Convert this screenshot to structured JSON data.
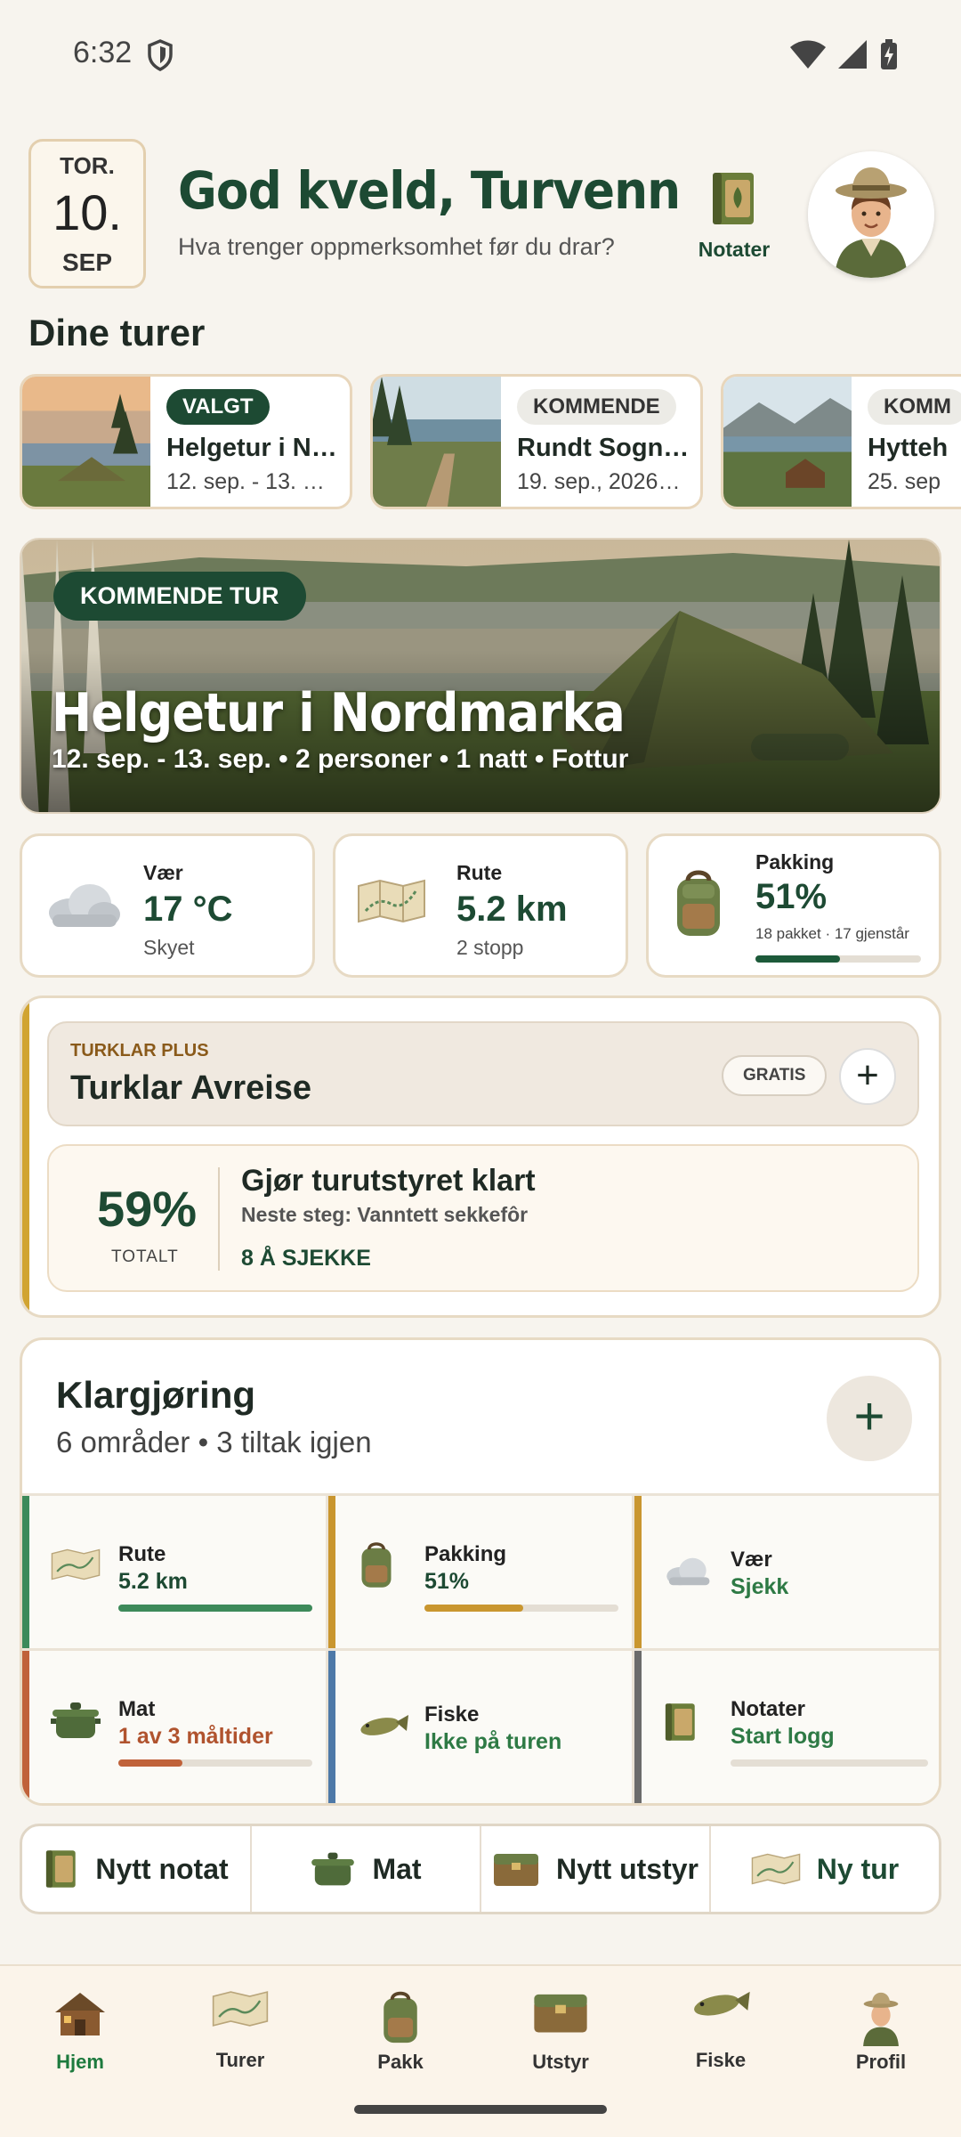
{
  "status": {
    "time": "6:32"
  },
  "header": {
    "date": {
      "dow": "TOR.",
      "day": "10.",
      "month": "SEP"
    },
    "title": "God kveld, Turvenn",
    "subtitle": "Hva trenger oppmerksomhet før du drar?",
    "notes_label": "Notater"
  },
  "trips": {
    "section_title": "Dine turer",
    "items": [
      {
        "badge": "VALGT",
        "name": "Helgetur i N…",
        "dates": "12. sep. - 13. …"
      },
      {
        "badge": "KOMMENDE",
        "name": "Rundt Sogns…",
        "dates": "19. sep., 2026…"
      },
      {
        "badge": "KOMM",
        "name": "Hytteh",
        "dates": "25. sep"
      }
    ]
  },
  "hero": {
    "badge": "KOMMENDE TUR",
    "title": "Helgetur i Nordmarka",
    "subtitle": "12. sep. - 13. sep. • 2 personer • 1 natt • Fottur"
  },
  "stats": {
    "weather": {
      "label": "Vær",
      "value": "17 °C",
      "sub": "Skyet"
    },
    "route": {
      "label": "Rute",
      "value": "5.2 km",
      "sub": "2 stopp"
    },
    "packing": {
      "label": "Pakking",
      "value": "51%",
      "sub": "18 pakket · 17 gjenstår",
      "progress": 0.51
    }
  },
  "turklar": {
    "kicker": "TURKLAR PLUS",
    "title": "Turklar Avreise",
    "gratis": "GRATIS",
    "percent": "59%",
    "percent_label": "TOTALT",
    "heading": "Gjør turutstyret klart",
    "next_step": "Neste steg: Vanntett sekkefôr",
    "link": "8 Å SJEKKE"
  },
  "prep": {
    "title": "Klargjøring",
    "subtitle": "6 områder • 3 tiltak igjen",
    "cells": [
      {
        "label": "Rute",
        "value": "5.2 km",
        "color": "#3d8a5a",
        "valcolor": "#1d4a33",
        "progress": 1.0
      },
      {
        "label": "Pakking",
        "value": "51%",
        "color": "#c9962f",
        "valcolor": "#1d4a33",
        "progress": 0.51
      },
      {
        "label": "Vær",
        "value": "Sjekk",
        "color": "#c9962f",
        "valcolor": "#2e7a45"
      },
      {
        "label": "Mat",
        "value": "1 av 3 måltider",
        "color": "#c0623a",
        "valcolor": "#b0532e",
        "progress": 0.33
      },
      {
        "label": "Fiske",
        "value": "Ikke på turen",
        "color": "#4e79a8",
        "valcolor": "#2e7a45"
      },
      {
        "label": "Notater",
        "value": "Start logg",
        "color": "#6b6b6b",
        "valcolor": "#2e7a45",
        "progress": 0.0
      }
    ]
  },
  "quick_actions": [
    {
      "label": "Nytt notat"
    },
    {
      "label": "Mat"
    },
    {
      "label": "Nytt utstyr"
    },
    {
      "label": "Ny tur"
    }
  ],
  "nav": [
    {
      "label": "Hjem"
    },
    {
      "label": "Turer"
    },
    {
      "label": "Pakk"
    },
    {
      "label": "Utstyr"
    },
    {
      "label": "Fiske"
    },
    {
      "label": "Profil"
    }
  ]
}
